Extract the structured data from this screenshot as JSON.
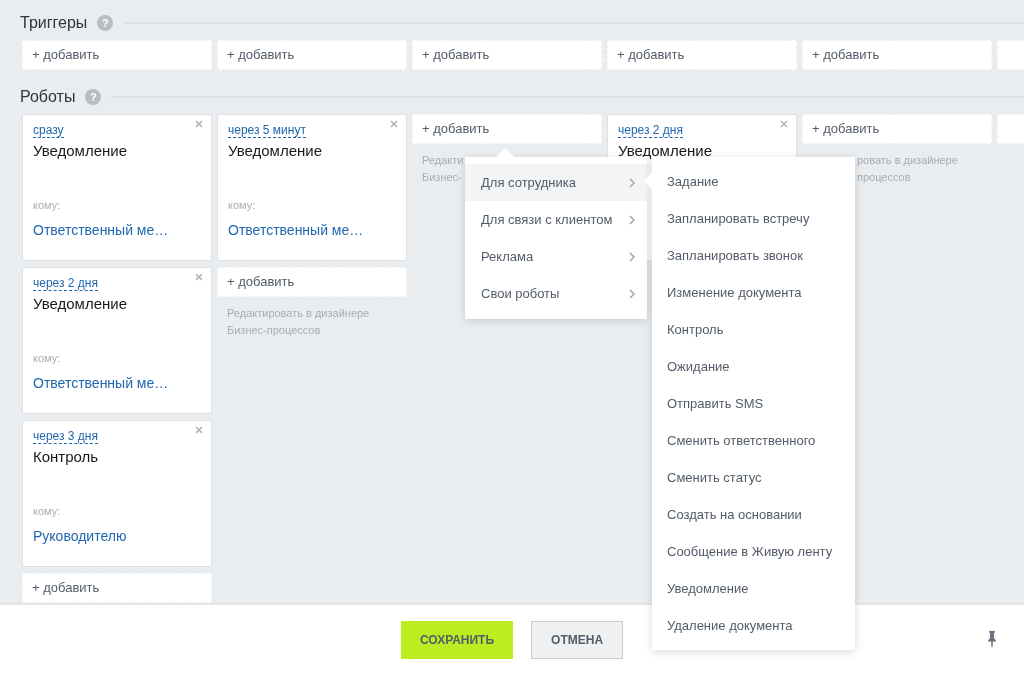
{
  "triggers": {
    "title": "Триггеры",
    "help": "?",
    "slots": [
      {
        "kind": "add",
        "label": "+ добавить"
      },
      {
        "kind": "add",
        "label": "+ добавить"
      },
      {
        "kind": "add",
        "label": "+ добавить"
      },
      {
        "kind": "add",
        "label": "+ добавить"
      },
      {
        "kind": "add",
        "label": "+ добавить"
      },
      {
        "kind": "blank"
      }
    ]
  },
  "robots": {
    "title": "Роботы",
    "help": "?",
    "columns": [
      {
        "items": [
          {
            "kind": "card",
            "delay": "сразу",
            "title": "Уведомление",
            "to_label": "кому:",
            "to": "Ответственный ме…"
          },
          {
            "kind": "card",
            "delay": "через 2 дня",
            "title": "Уведомление",
            "to_label": "кому:",
            "to": "Ответственный ме…"
          },
          {
            "kind": "card",
            "delay": "через 3 дня",
            "title": "Контроль",
            "to_label": "кому:",
            "to": "Руководителю"
          },
          {
            "kind": "add",
            "label": "+ добавить"
          }
        ]
      },
      {
        "items": [
          {
            "kind": "card",
            "delay": "через 5 минут",
            "title": "Уведомление",
            "to_label": "кому:",
            "to": "Ответственный ме…"
          },
          {
            "kind": "add",
            "label": "+ добавить"
          },
          {
            "kind": "edit",
            "lines": [
              "Редактировать в дизайнере",
              "Бизнес-процессов"
            ]
          }
        ]
      },
      {
        "items": [
          {
            "kind": "add",
            "label": "+ добавить"
          },
          {
            "kind": "edit",
            "lines": [
              "Редакти",
              "Бизнес-"
            ]
          }
        ]
      },
      {
        "items": [
          {
            "kind": "card",
            "delay": "через 2 дня",
            "title": "Уведомление"
          }
        ]
      },
      {
        "items": [
          {
            "kind": "add",
            "label": "+ добавить"
          },
          {
            "kind": "edit_tail",
            "lines": [
              "ровать в дизайнере",
              "процессов"
            ]
          }
        ]
      },
      {
        "items": [
          {
            "kind": "add"
          }
        ]
      }
    ]
  },
  "menu": {
    "items": [
      {
        "label": "Для сотрудника",
        "selected": true
      },
      {
        "label": "Для связи с клиентом",
        "selected": false
      },
      {
        "label": "Реклама",
        "selected": false
      },
      {
        "label": "Свои роботы",
        "selected": false
      }
    ],
    "submenu": {
      "items": [
        {
          "label": "Задание"
        },
        {
          "label": "Запланировать встречу"
        },
        {
          "label": "Запланировать звонок"
        },
        {
          "label": "Изменение документа"
        },
        {
          "label": "Контроль"
        },
        {
          "label": "Ожидание"
        },
        {
          "label": "Отправить SMS"
        },
        {
          "label": "Сменить ответственного"
        },
        {
          "label": "Сменить статус"
        },
        {
          "label": "Создать на основании"
        },
        {
          "label": "Сообщение в Живую ленту"
        },
        {
          "label": "Уведомление"
        },
        {
          "label": "Удаление документа"
        }
      ]
    }
  },
  "footer": {
    "buttons": [
      {
        "label": "СОХРАНИТЬ",
        "kind": "primary"
      },
      {
        "label": "ОТМЕНА",
        "kind": "secondary"
      }
    ]
  }
}
